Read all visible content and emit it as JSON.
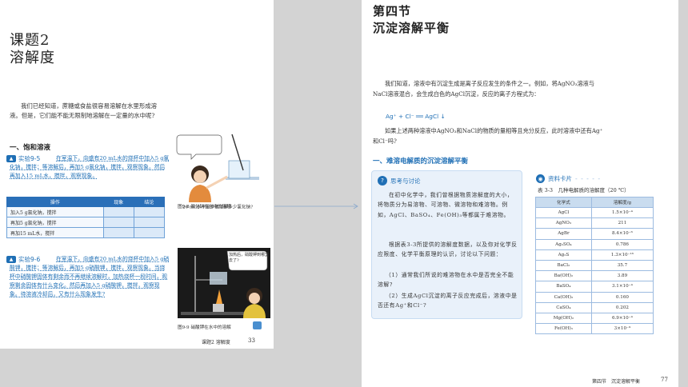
{
  "left_page": {
    "lesson_label": "课题2",
    "lesson_title": "溶解度",
    "intro": "我们已经知道，蔗糖或食盐很容易溶解在水里形成溶液。但是，它们能不能无限制地溶解在一定量的水中呢?",
    "section1": "一、饱和溶液",
    "exp1_label": "实验9-5",
    "exp1_text": "在室温下，向盛有20 mL水的烧杯中加入5 g氯化钠，搅拌；等溶解后，再加5 g氯化钠，搅拌，观察现象。然后再加入15 mL水，搅拌，观察现象。",
    "speech1": "20 mL水中最多能溶解多少氯化钠?",
    "fig1_caption": "图9-8 氯化钠在水中的溶解",
    "table": {
      "headers": [
        "操作",
        "现象",
        "结论"
      ],
      "rows": [
        "加入5 g氯化钠，搅拌",
        "再加5 g氯化钠，搅拌",
        "再加15 mL水，搅拌"
      ]
    },
    "exp2_label": "实验9-6",
    "exp2_text": "在室温下，向盛有20 mL水的烧杯中加入5 g硝酸钾，搅拌；等溶解后，再加5 g硝酸钾，搅拌，观察现象。当烧杯中硝酸钾固体有剩余而不再继续溶解时，加热烧杯一段时间，观察剩余固体有什么变化。然后再加入5 g硝酸钾，搅拌，观察现象。待溶液冷却后，又有什么现象发生?",
    "speech2": "加热后，硝酸钾到哪里去了?",
    "fig2_caption": "图9-9 硝酸钾在水中的溶解",
    "footer": "课题2 溶解度",
    "page_no": "33"
  },
  "right_page": {
    "section_label": "第四节",
    "section_title": "沉淀溶解平衡",
    "intro": "我们知道，溶液中有沉淀生成是离子反应发生的条件之一。例如，将AgNO₃溶液与NaCl溶液混合，会生成白色的AgCl沉淀，反应的离子方程式为：",
    "equation": "Ag⁺ + Cl⁻ ══ AgCl ↓",
    "question": "如果上述两种溶液中AgNO₃和NaCl的物质的量相等且充分反应，此时溶液中还有Ag⁺和Cl⁻吗?",
    "section1": "一、难溶电解质的沉淀溶解平衡",
    "discussion_head": "思考与讨论",
    "discussion_p1": "在初中化学中，我们曾根据物质溶解度的大小，将物质分为易溶物、可溶物、微溶物和难溶物。例如，AgCl、BaSO₄、Fe(OH)₃等都属于难溶物。",
    "discussion_p2": "根据表3-3所提供的溶解度数据，以及你对化学反应限度、化学平衡原理的认识，讨论以下问题：",
    "discussion_q1": "（1）通常我们所说的难溶物在水中是否完全不能溶解?",
    "discussion_q2": "（2）生成AgCl沉淀的离子反应完成后，溶液中是否还有Ag⁺和Cl⁻?",
    "card_head": "资料卡片",
    "table_title": "表 3-3　几种电解质的溶解度（20 ℃）",
    "table_headers": [
      "化学式",
      "溶解度/g"
    ],
    "table_rows": [
      [
        "AgCl",
        "1.5×10⁻⁴"
      ],
      [
        "AgNO₃",
        "211"
      ],
      [
        "AgBr",
        "8.4×10⁻⁶"
      ],
      [
        "Ag₂SO₄",
        "0.786"
      ],
      [
        "Ag₂S",
        "1.3×10⁻¹⁶"
      ],
      [
        "BaCl₂",
        "35.7"
      ],
      [
        "Ba(OH)₂",
        "3.89"
      ],
      [
        "BaSO₄",
        "3.1×10⁻⁴"
      ],
      [
        "Ca(OH)₂",
        "0.160"
      ],
      [
        "CaSO₄",
        "0.202"
      ],
      [
        "Mg(OH)₂",
        "6.9×10⁻⁴"
      ],
      [
        "Fe(OH)₃",
        "3×10⁻⁹"
      ]
    ],
    "footer": "第四节　沉淀溶解平衡",
    "page_no": "77"
  }
}
